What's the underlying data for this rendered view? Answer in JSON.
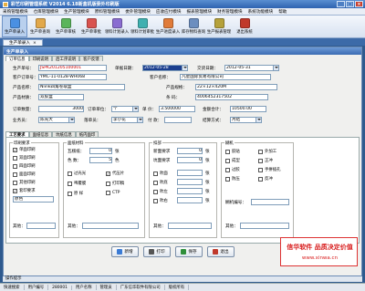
{
  "window": {
    "title": "彩艺印刷管理系统  V2014  6.18新盒机版委外印刷版"
  },
  "menu": [
    "采购管理模块",
    "仓库管理模块",
    "生产管理模块",
    "原料管理模块",
    "委外管理模块",
    "应收应付模块",
    "报表管理模块",
    "财务管理模块",
    "系统功能模块",
    "帮助"
  ],
  "toolbar": [
    "生产单录入",
    "生产单查询",
    "生产单审核",
    "生产单审批",
    "领料计划录入",
    "领料计划审批",
    "生产进度录入",
    "库存物料查询",
    "生产报表管理",
    "退出系统"
  ],
  "tab": {
    "label": "生产单录入"
  },
  "form": {
    "title": "生产单录入",
    "subtabs": [
      "订单信息",
      "印刷说明",
      "后工序说明",
      "客户反馈"
    ],
    "order_no_label": "生产单号：",
    "order_no": "JSPK201205100001",
    "date_label": "单据日期：",
    "date": "2012-05-28",
    "delivery_label": "交货日期：",
    "delivery": "2012-05-31",
    "cust_order_label": "客户订单号：",
    "cust_order": "YMC-11-0128-WH068",
    "customer_label": "客户名称：",
    "customer": "凡星国际贸易有限公司",
    "product_label": "产品名称：",
    "product": "Nlink四角卷取盒",
    "spec_label": "产品规格：",
    "spec": "22×12×420M",
    "material_label": "产品材质：",
    "material": "双胶盒",
    "code_label": "条 码：",
    "code": "4006452317502",
    "qty_label": "订单数量：",
    "qty": "3000",
    "unit_label": "订单单位：",
    "unit": "个",
    "price_label": "单 价：",
    "price": "3.500000",
    "amount_label": "金额合计：",
    "amount": "10500.00",
    "salesman_label": "业务员：",
    "salesman": "陈光大",
    "maker_label": "落单员：",
    "maker": "李小花",
    "pay_label": "付 款：",
    "pay": "",
    "settle_label": "结算方式：",
    "settle": "月结"
  },
  "panel_tabs": [
    "工艺要求",
    "面纸信息",
    "坑纸信息",
    "纸内面印"
  ],
  "craft": {
    "print_group": "印刷要求",
    "print_opts": [
      {
        "label": "单面印刷",
        "checked": true
      },
      {
        "label": "双面印刷",
        "checked": false
      },
      {
        "label": "四面印刷",
        "checked": false
      },
      {
        "label": "面面印刷",
        "checked": false
      },
      {
        "label": "其他印刷",
        "checked": false
      },
      {
        "label": "套印要求",
        "checked": true
      }
    ],
    "extra_value": "原色",
    "other_label": "其他：",
    "paper_group": "面纸材料",
    "sheet_label": "瓦楞纸：",
    "sheet_val": "0",
    "sheet_unit": "张",
    "colors_label": "色 数：",
    "colors_val": "5",
    "colors_unit": "色",
    "paper_opts": [
      {
        "label": "过光光",
        "checked": false
      },
      {
        "label": "代压片",
        "checked": true
      },
      {
        "label": "啤覆膜",
        "checked": false
      },
      {
        "label": "打印稿",
        "checked": false
      },
      {
        "label": "原 样",
        "checked": false
      },
      {
        "label": "CTP",
        "checked": false
      }
    ],
    "other2_label": "其他：",
    "box_group": "扣部",
    "box_rows": [
      {
        "label": "新面要求",
        "val": "0",
        "unit": "张"
      },
      {
        "label": "坑面要求",
        "val": "0",
        "unit": "张"
      },
      {
        "label": "吹面",
        "val": "",
        "unit": "张"
      },
      {
        "label": "吹底",
        "val": "",
        "unit": "张"
      },
      {
        "label": "吹左",
        "val": "",
        "unit": "张"
      },
      {
        "label": "吹右",
        "val": "",
        "unit": "张"
      }
    ],
    "other3_label": "其他：",
    "paste_group": "糊机",
    "paste_opts": [
      {
        "label": "胶贴",
        "checked": false
      },
      {
        "label": "外加工",
        "checked": false
      },
      {
        "label": "成型",
        "checked": false
      },
      {
        "label": "正冲",
        "checked": false
      },
      {
        "label": "过胶",
        "checked": false
      },
      {
        "label": "手拼插孔",
        "checked": false
      },
      {
        "label": "防压",
        "checked": false
      },
      {
        "label": "反冲",
        "checked": false
      }
    ],
    "other4_label": "其他：",
    "remark_label": "糊机编号："
  },
  "buttons": [
    {
      "label": "新增",
      "color": "#3a7bd5"
    },
    {
      "label": "打印",
      "color": "#555"
    },
    {
      "label": "保存",
      "color": "#2f8f3a"
    },
    {
      "label": "退出",
      "color": "#c0392b"
    }
  ],
  "promo": {
    "line1": "信华软件 品质决定价值",
    "line2": "www.xinwa.cn"
  },
  "opbar": {
    "label": "操作提示"
  },
  "status": [
    "快速搜索",
    "用户编号",
    "280001",
    "用户名称",
    "管理员",
    "广东信华软件有限公司",
    "版权所有"
  ]
}
